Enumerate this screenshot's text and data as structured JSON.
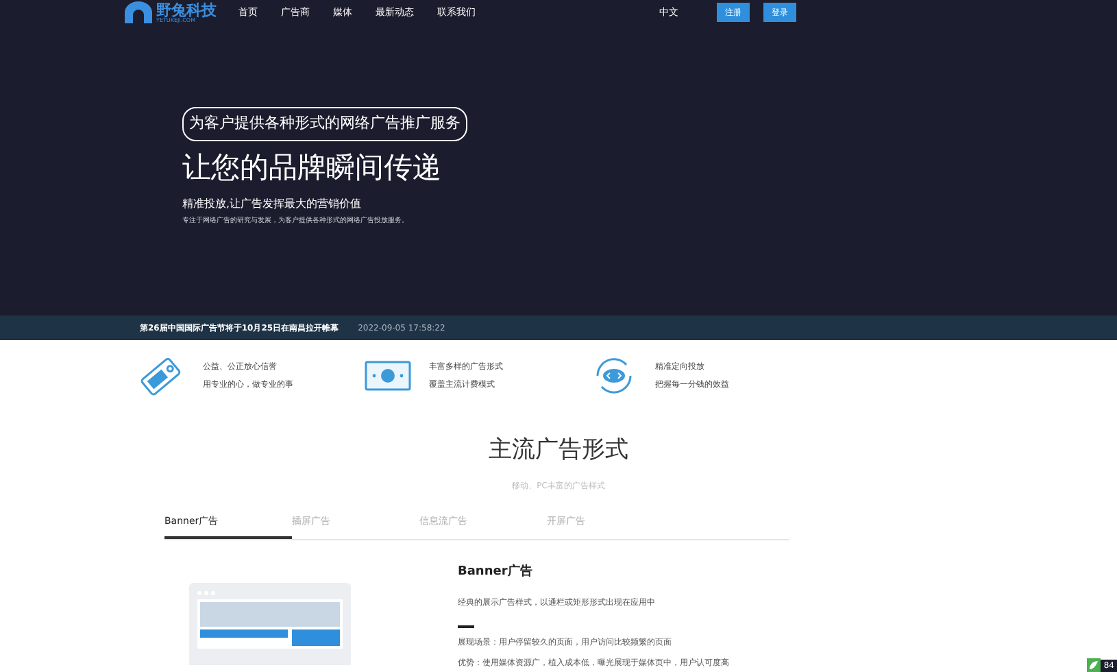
{
  "header": {
    "logo_text": "野兔科技",
    "logo_domain": "YETUKEJI.COM",
    "nav": [
      {
        "label": "首页",
        "selected": false
      },
      {
        "label": "广告商",
        "selected": false
      },
      {
        "label": "媒体",
        "selected": false
      },
      {
        "label": "最新动态",
        "selected": false
      },
      {
        "label": "联系我们",
        "selected": false
      }
    ],
    "language": "中文",
    "buttons": [
      "注册",
      "登录"
    ]
  },
  "hero": {
    "tagline": "为客户提供各种形式的网络广告推广服务",
    "title": "让您的品牌瞬间传递",
    "subtitle": "精准投放,让广告发挥最大的营销价值",
    "description": "专注于网络广告的研究与发展，为客户提供各种形式的网络广告投放服务。"
  },
  "ticker": {
    "headline": "第26届中国国际广告节将于10月25日在南昌拉开帷幕",
    "time": "2022-09-05 17:58:22"
  },
  "features": [
    {
      "kind": "tag",
      "line1": "公益、公正放心信誉",
      "line2": "用专业的心，做专业的事"
    },
    {
      "kind": "money",
      "line1": "丰富多样的广告形式",
      "line2": "覆盖主流计费模式"
    },
    {
      "kind": "target",
      "line1": "精准定向投放",
      "line2": "把握每一分钱的效益"
    }
  ],
  "section": {
    "title": "主流广告形式",
    "subtitle": "移动、PC丰富的广告样式",
    "tabs": [
      {
        "label": "Banner广告",
        "selected": true
      },
      {
        "label": "插屏广告",
        "selected": false
      },
      {
        "label": "信息流广告",
        "selected": false
      },
      {
        "label": "开屏广告",
        "selected": false
      }
    ]
  },
  "detail": {
    "title": "Banner广告",
    "intro": "经典的展示广告样式，以通栏或矩形形式出现在应用中",
    "points": [
      "展现场景：用户停留较久的页面，用户访问比较频繁的页面",
      "优势：使用媒体资源广，植入成本低，曝光展现于媒体页中，用户认可度高"
    ]
  },
  "corner_badge": "84"
}
